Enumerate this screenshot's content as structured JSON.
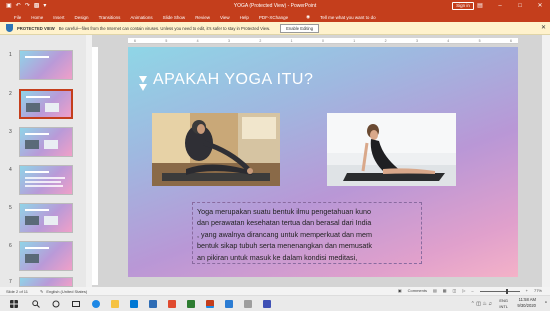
{
  "window": {
    "title": "YOGA (Protected View) - PowerPoint",
    "signin_label": "Sign in"
  },
  "ribbon": {
    "tabs": [
      "File",
      "Home",
      "Insert",
      "Design",
      "Transitions",
      "Animations",
      "Slide Show",
      "Review",
      "View",
      "Help",
      "PDF-XChange"
    ],
    "tell_me": "Tell me what you want to do"
  },
  "protected_view": {
    "label": "PROTECTED VIEW",
    "message": "Be careful—files from the Internet can contain viruses. Unless you need to edit, it's safer to stay in Protected View.",
    "enable_button": "Enable Editing"
  },
  "thumbnails": {
    "numbers": [
      "1",
      "2",
      "3",
      "4",
      "5",
      "6",
      "7"
    ]
  },
  "slide": {
    "title": "APAKAH YOGA ITU?",
    "body_lines": [
      "Yoga merupakan suatu bentuk ilmu pengetahuan kuno",
      "dan perawatan kesehatan tertua dan berasal dari India",
      ", yang awalnya dirancang untuk memperkuat dan mem",
      "bentuk sikap tubuh serta menenangkan dan memusatk",
      "an pikiran untuk masuk ke dalam kondisi meditasi,"
    ]
  },
  "ruler": {
    "ticks": [
      "6",
      "5",
      "4",
      "3",
      "2",
      "1",
      "0",
      "1",
      "2",
      "3",
      "4",
      "5",
      "6"
    ]
  },
  "status": {
    "slide_info": "Slide 2 of 11",
    "language": "English (United States)",
    "comments": "Comments",
    "zoom": "77%"
  },
  "tray": {
    "lang_top": "ENG",
    "lang_bottom": "INTL",
    "time": "11:58 AM",
    "date": "9/30/2020"
  },
  "colors": {
    "accent": "#c43e1c",
    "slide_gradient": [
      "#8fd6e6",
      "#b997d6",
      "#f4b2c8"
    ]
  }
}
